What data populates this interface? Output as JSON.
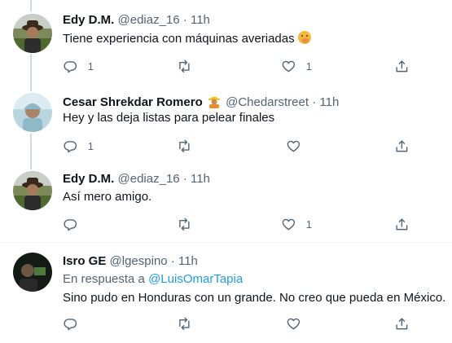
{
  "tweets": [
    {
      "name": "Edy D.M.",
      "handle": "@ediaz_16",
      "dot": "·",
      "time": "11h",
      "text": "Tiene experiencia con máquinas averiadas",
      "emoji": "face-with-hand-over-mouth",
      "reply_count": "1",
      "retweet_count": "",
      "like_count": "1"
    },
    {
      "name": "Cesar Shrekdar Romero",
      "badge": "construction-worker-emoji",
      "handle": "@Chedarstreet",
      "dot": "·",
      "time": "11h",
      "text": "Hey y las deja listas para pelear finales",
      "reply_count": "1",
      "retweet_count": "",
      "like_count": ""
    },
    {
      "name": "Edy D.M.",
      "handle": "@ediaz_16",
      "dot": "·",
      "time": "11h",
      "text": "Así mero amigo.",
      "reply_count": "",
      "retweet_count": "",
      "like_count": "1"
    },
    {
      "name": "Isro GE",
      "handle": "@lgespino",
      "dot": "·",
      "time": "11h",
      "reply_prefix": "En respuesta a",
      "reply_to": "@LuisOmarTapia",
      "text": "Sino pudo en Honduras con un grande. No creo que pueda en México.",
      "reply_count": "",
      "retweet_count": "",
      "like_count": ""
    }
  ],
  "icons": {
    "reply": "reply-icon",
    "retweet": "retweet-icon",
    "like": "like-icon",
    "share": "share-icon"
  },
  "colors": {
    "text": "#0f1419",
    "secondary": "#536471",
    "link": "#1d9bf0",
    "thread_line": "#cfd9de"
  }
}
